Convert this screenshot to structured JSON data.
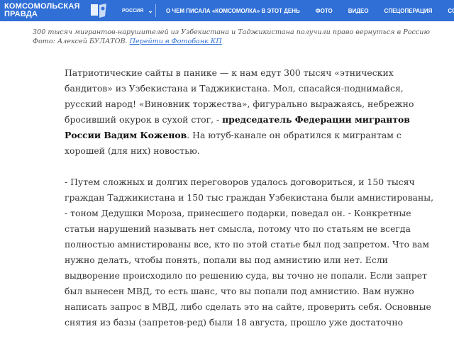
{
  "header": {
    "logo_line1": "Комсомольская",
    "logo_line2": "правда",
    "region": "Россия",
    "nav": [
      "О чем писала «Комсомолка» в этот день",
      "Фото",
      "Видео",
      "Спецоперация",
      "Ссс"
    ],
    "colors": {
      "bar": "#2f6fd6",
      "text": "#ffffff"
    }
  },
  "caption": {
    "line1": "300 тысяч мигрантов-нарушителей из Узбекистана и Таджикистана получили право вернуться в Россию",
    "photo_credit": "Фото: Алексей БУЛАТОВ.",
    "photobank_link": "Перейти в Фотобанк КП"
  },
  "article": {
    "p1_a": "Патриотические сайты в панике — к нам едут 300 тысяч «этнических бандитов» из Узбекистана и Таджикистана. Мол, спасайся-поднимайся, русский народ! «Виновник торжества», фигурально выражаясь, небрежно бросивший окурок в сухой стог, - ",
    "p1_bold": "председатель Федерации мигрантов России Вадим Коженов",
    "p1_b": ". На ютуб-канале он обратился к мигрантам с хорошей (для них) новостью.",
    "p2": "- Путем сложных и долгих переговоров удалось договориться, и 150 тысяч граждан Таджикистана и 150 тыс граждан Узбекистана были амнистированы, - тоном Дедушки Мороза, принесшего подарки, поведал он. - Конкретные статьи нарушений называть нет смысла, потому что по статьям не всегда полностью амнистированы все, кто по этой статье был под запретом. Что вам нужно делать, чтобы понять, попали вы под амнистию или нет. Если выдворение происходило по решению суда, вы точно не попали. Если запрет был вынесен МВД, то есть шанс, что вы попали под амнистию. Вам нужно написать запрос в МВД, либо сделать это на сайте, проверить себя. Основные снятия из базы (запретов-ред) были 18 августа, прошло уже достаточно"
  }
}
